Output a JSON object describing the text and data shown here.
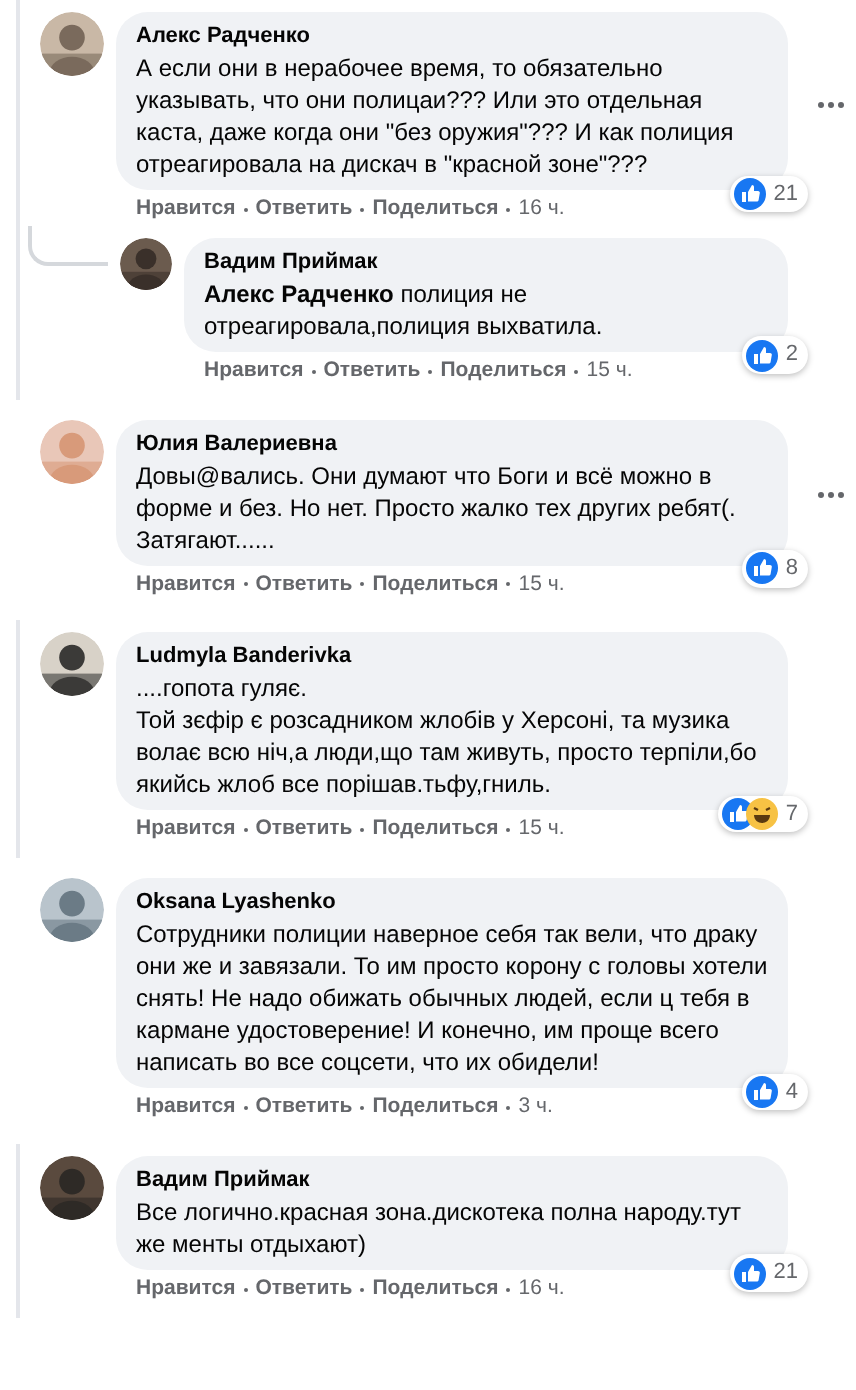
{
  "blocks": [
    {
      "thread_line": true,
      "comments": [
        {
          "kind": "comment",
          "author": "Алекс Радченко",
          "text": "А если они в нерабочее время, то обязательно указывать, что они полицаи??? Или это отдельная каста, даже когда они \"без оружия\"??? И как полиция отреагировала на дискач в \"красной зоне\"???",
          "menu": true,
          "reactions": [
            {
              "kind": "like"
            }
          ],
          "count": "21",
          "actions": [
            "Нравится",
            "Ответить",
            "Поделиться"
          ],
          "time": "16 ч."
        },
        {
          "kind": "reply",
          "author": "Вадим Приймак",
          "text": "**Алекс Радченко** полиция не отреагировала,полиция выхватила.",
          "menu": false,
          "reactions": [
            {
              "kind": "like"
            }
          ],
          "count": "2",
          "actions": [
            "Нравится",
            "Ответить",
            "Поделиться"
          ],
          "time": "15 ч."
        }
      ]
    },
    {
      "thread_line": false,
      "comments": [
        {
          "kind": "comment",
          "author": "Юлия Валериевна",
          "text": "Довы@вались. Они думают что Боги и всё можно в форме и без. Но нет. Просто жалко тех других ребят(. Затягают......",
          "menu": true,
          "reactions": [
            {
              "kind": "like"
            }
          ],
          "count": "8",
          "actions": [
            "Нравится",
            "Ответить",
            "Поделиться"
          ],
          "time": "15 ч."
        }
      ]
    },
    {
      "thread_line": true,
      "comments": [
        {
          "kind": "comment",
          "author": "Ludmyla Banderivka",
          "text": "....гопота гуляє.\nТой зєфір є розсадником жлобів у Херсоні, та музика волає всю ніч,а люди,що там живуть, просто терпіли,бо якийсь жлоб все порішав.тьфу,гниль.",
          "menu": false,
          "reactions": [
            {
              "kind": "like"
            },
            {
              "kind": "haha"
            }
          ],
          "count": "7",
          "actions": [
            "Нравится",
            "Ответить",
            "Поделиться"
          ],
          "time": "15 ч."
        }
      ]
    },
    {
      "thread_line": false,
      "comments": [
        {
          "kind": "comment",
          "author": "Oksana Lyashenko",
          "text": "Сотрудники полиции наверное себя так вели, что драку они же и завязали. То им просто корону с головы хотели снять! Не надо обижать обычных людей, если ц тебя в кармане удостоверение! И конечно, им проще всего написать во все соцсети, что их обидели!",
          "menu": false,
          "reactions": [
            {
              "kind": "like"
            }
          ],
          "count": "4",
          "actions": [
            "Нравится",
            "Ответить",
            "Поделиться"
          ],
          "time": "3 ч."
        }
      ]
    },
    {
      "thread_line": true,
      "comments": [
        {
          "kind": "comment",
          "author": "Вадим Приймак",
          "text": "Все логично.красная зона.дискотека полна народу.тут же менты отдыхают)",
          "menu": false,
          "reactions": [
            {
              "kind": "like"
            }
          ],
          "count": "21",
          "actions": [
            "Нравится",
            "Ответить",
            "Поделиться"
          ],
          "time": "16 ч."
        }
      ]
    }
  ]
}
